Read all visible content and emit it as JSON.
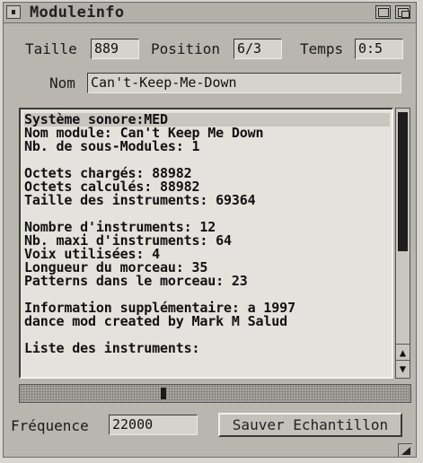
{
  "window": {
    "title": "Moduleinfo"
  },
  "fields": {
    "taille_label": "Taille",
    "taille_value": "889",
    "position_label": "Position",
    "position_value": "6/3",
    "temps_label": "Temps",
    "temps_value": "0:5",
    "nom_label": "Nom",
    "nom_value": "Can't-Keep-Me-Down"
  },
  "info_lines": [
    "Système sonore:MED",
    "Nom module: Can't Keep Me Down",
    "Nb. de sous-Modules: 1",
    "",
    "Octets chargés: 88982",
    "Octets calculés: 88982",
    "Taille des instruments: 69364",
    "",
    "Nombre d'instruments: 12",
    "Nb. maxi d'instruments: 64",
    "Voix utilisées: 4",
    "Longueur du morceau: 35",
    "Patterns dans le morceau: 23",
    "",
    "Information supplémentaire: a 1997",
    "dance mod created by Mark M Salud",
    "",
    "Liste des instruments:"
  ],
  "bottom": {
    "frequence_label": "Fréquence",
    "frequence_value": "22000",
    "save_button": "Sauver Echantillon"
  },
  "icons": {
    "close": "close-icon",
    "zoom": "zoom-icon",
    "depth": "depth-icon",
    "scroll_up": "arrow-up-icon",
    "scroll_down": "arrow-down-icon",
    "resize": "resize-icon"
  }
}
